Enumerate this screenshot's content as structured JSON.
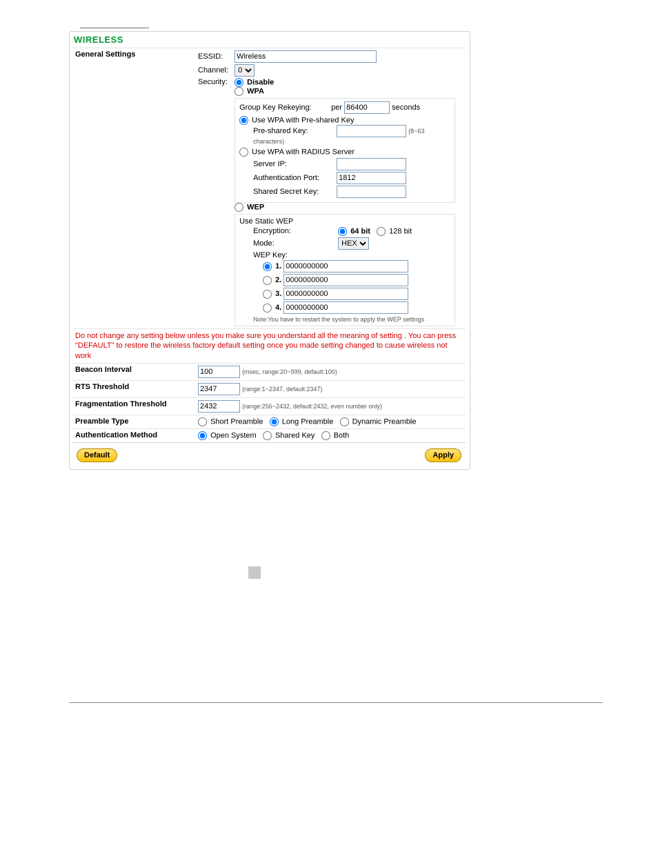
{
  "page_title": "WIRELESS",
  "sections": {
    "general": "General Settings",
    "beacon": "Beacon Interval",
    "rts": "RTS Threshold",
    "frag": "Fragmentation Threshold",
    "preamble": "Preamble Type",
    "auth": "Authentication Method"
  },
  "general": {
    "essid_label": "ESSID:",
    "essid_value": "Wireless",
    "channel_label": "Channel:",
    "channel_value": "0",
    "security_label": "Security:",
    "sec_disable": "Disable",
    "sec_wpa": "WPA",
    "sec_wep": "WEP",
    "security_selected": "disable"
  },
  "wpa": {
    "group_key_label": "Group Key Rekeying:",
    "group_key_per": "per",
    "group_key_value": "86400",
    "group_key_unit": "seconds",
    "use_psk_label": "Use WPA with Pre-shared Key",
    "psk_label": "Pre-shared Key:",
    "psk_value": "",
    "psk_hint": "(8~63 characters)",
    "use_radius_label": "Use WPA with RADIUS Server",
    "server_ip_label": "Server IP:",
    "server_ip_value": "",
    "auth_port_label": "Authentication Port:",
    "auth_port_value": "1812",
    "shared_secret_label": "Shared Secret Key:",
    "shared_secret_value": "",
    "mode_selected": "psk"
  },
  "wep": {
    "use_static_label": "Use Static WEP",
    "encryption_label": "Encryption:",
    "enc_64": "64 bit",
    "enc_128": "128 bit",
    "enc_selected": "64",
    "mode_label": "Mode:",
    "mode_value": "HEX",
    "key_label": "WEP Key:",
    "keys": [
      "0000000000",
      "0000000000",
      "0000000000",
      "0000000000"
    ],
    "key_selected": "1",
    "note": "Note:You have to restart the system to apply the WEP settings"
  },
  "warning_text": "Do not change any setting below unless you make sure you understand all the meaning of setting . You can press \"DEFAULT\" to restore the wireless factory default setting once you made setting changed to cause wireless not work",
  "beacon": {
    "value": "100",
    "hint": "(msec, range:20~999, default:100)"
  },
  "rts": {
    "value": "2347",
    "hint": "(range:1~2347, default:2347)"
  },
  "frag": {
    "value": "2432",
    "hint": "(range:256~2432, default:2432, even number only)"
  },
  "preamble": {
    "short": "Short Preamble",
    "long": "Long Preamble",
    "dynamic": "Dynamic Preamble",
    "selected": "long"
  },
  "auth": {
    "open": "Open System",
    "shared": "Shared Key",
    "both": "Both",
    "selected": "open"
  },
  "buttons": {
    "default": "Default",
    "apply": "Apply"
  }
}
